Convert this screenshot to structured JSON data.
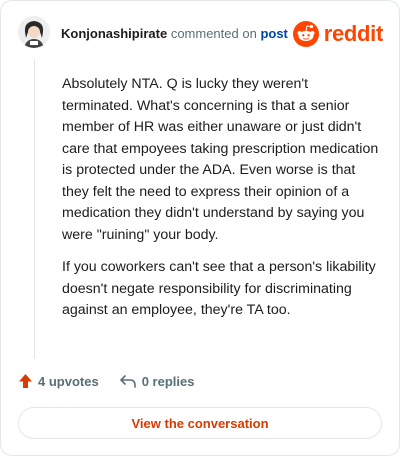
{
  "header": {
    "username": "Konjonashipirate",
    "action_text": "commented on",
    "post_link": "post"
  },
  "brand": {
    "wordmark": "reddit",
    "icon": "reddit-alien-icon",
    "color": "#ff4500"
  },
  "comment": {
    "paragraphs": [
      "Absolutely NTA. Q is lucky they weren't terminated. What's concerning is that a senior member of HR was either unaware or just didn't care that empoyees taking prescription medication is protected under the ADA. Even worse is that they felt the need to express their opinion of a medication they didn't understand by saying you were \"ruining\" your body.",
      "If you coworkers can't see that a person's likability doesn't negate responsibility for discriminating against an employee, they're TA too."
    ]
  },
  "actions": {
    "upvotes": "4 upvotes",
    "replies": "0 replies",
    "upvote_icon": "upvote-arrow-icon",
    "reply_icon": "reply-icon"
  },
  "cta": {
    "label": "View the conversation"
  }
}
